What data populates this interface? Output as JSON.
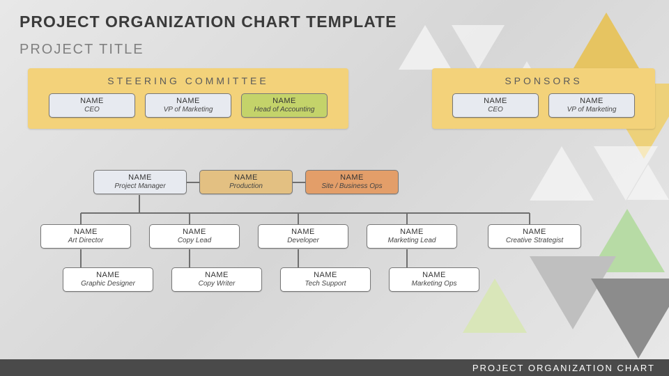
{
  "title": "PROJECT ORGANIZATION CHART TEMPLATE",
  "subtitle": "PROJECT TITLE",
  "footer": "PROJECT ORGANIZATION CHART",
  "steering": {
    "label": "STEERING COMMITTEE",
    "members": [
      {
        "name": "NAME",
        "role": "CEO"
      },
      {
        "name": "NAME",
        "role": "VP of Marketing"
      },
      {
        "name": "NAME",
        "role": "Head of Accounting"
      }
    ]
  },
  "sponsors": {
    "label": "SPONSORS",
    "members": [
      {
        "name": "NAME",
        "role": "CEO"
      },
      {
        "name": "NAME",
        "role": "VP of Marketing"
      }
    ]
  },
  "leads": [
    {
      "name": "NAME",
      "role": "Project Manager"
    },
    {
      "name": "NAME",
      "role": "Production"
    },
    {
      "name": "NAME",
      "role": "Site / Business Ops"
    }
  ],
  "row2": [
    {
      "name": "NAME",
      "role": "Art Director"
    },
    {
      "name": "NAME",
      "role": "Copy Lead"
    },
    {
      "name": "NAME",
      "role": "Developer"
    },
    {
      "name": "NAME",
      "role": "Marketing Lead"
    },
    {
      "name": "NAME",
      "role": "Creative Strategist"
    }
  ],
  "row3": [
    {
      "name": "NAME",
      "role": "Graphic Designer"
    },
    {
      "name": "NAME",
      "role": "Copy Writer"
    },
    {
      "name": "NAME",
      "role": "Tech Support"
    },
    {
      "name": "NAME",
      "role": "Marketing Ops"
    }
  ]
}
